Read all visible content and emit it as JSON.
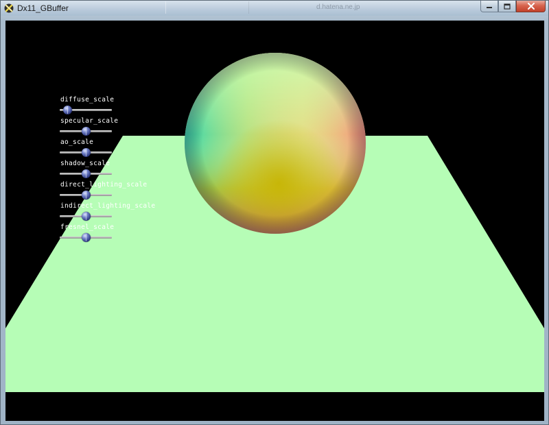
{
  "window": {
    "title": "Dx11_GBuffer",
    "background_tab_1": "",
    "background_tab_2": "d.hatena.ne.jp"
  },
  "colors": {
    "floor": "#b6fdb6",
    "viewport_background": "#000000",
    "slider_label": "#ffffff",
    "slider_knob": "#3a4690"
  },
  "icons": {
    "app_icon": "directx-x-icon",
    "minimize": "minimize-icon",
    "maximize": "maximize-icon",
    "close": "close-icon"
  },
  "sliders": [
    {
      "label": "diffuse_scale",
      "value": 0.15
    },
    {
      "label": "specular_scale",
      "value": 0.5
    },
    {
      "label": "ao_scale",
      "value": 0.5
    },
    {
      "label": "shadow_scale",
      "value": 0.5
    },
    {
      "label": "direct_lighting_scale",
      "value": 0.5
    },
    {
      "label": "indirect_lighting_scale",
      "value": 0.5
    },
    {
      "label": "fresnel_scale",
      "value": 0.5
    }
  ]
}
